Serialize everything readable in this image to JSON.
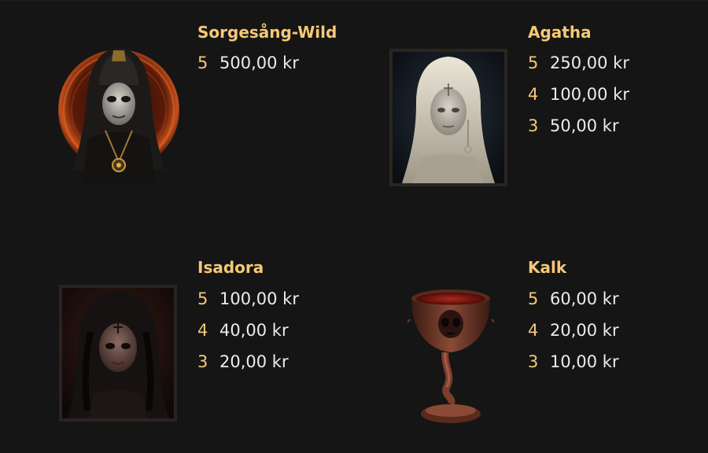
{
  "symbols": [
    {
      "name": "Sorgesång-Wild",
      "icon": "hooded-wild-figure-icon",
      "payouts": [
        {
          "count": "5",
          "amount": "500,00 kr"
        }
      ]
    },
    {
      "name": "Agatha",
      "icon": "pale-woman-portrait-icon",
      "payouts": [
        {
          "count": "5",
          "amount": "250,00 kr"
        },
        {
          "count": "4",
          "amount": "100,00 kr"
        },
        {
          "count": "3",
          "amount": "50,00 kr"
        }
      ]
    },
    {
      "name": "Isadora",
      "icon": "dark-haired-woman-portrait-icon",
      "payouts": [
        {
          "count": "5",
          "amount": "100,00 kr"
        },
        {
          "count": "4",
          "amount": "40,00 kr"
        },
        {
          "count": "3",
          "amount": "20,00 kr"
        }
      ]
    },
    {
      "name": "Kalk",
      "icon": "skull-chalice-icon",
      "payouts": [
        {
          "count": "5",
          "amount": "60,00 kr"
        },
        {
          "count": "4",
          "amount": "20,00 kr"
        },
        {
          "count": "3",
          "amount": "10,00 kr"
        }
      ]
    }
  ],
  "colors": {
    "background": "#151515",
    "title": "#f5c877",
    "count": "#f5c877",
    "amount": "#ececec"
  }
}
